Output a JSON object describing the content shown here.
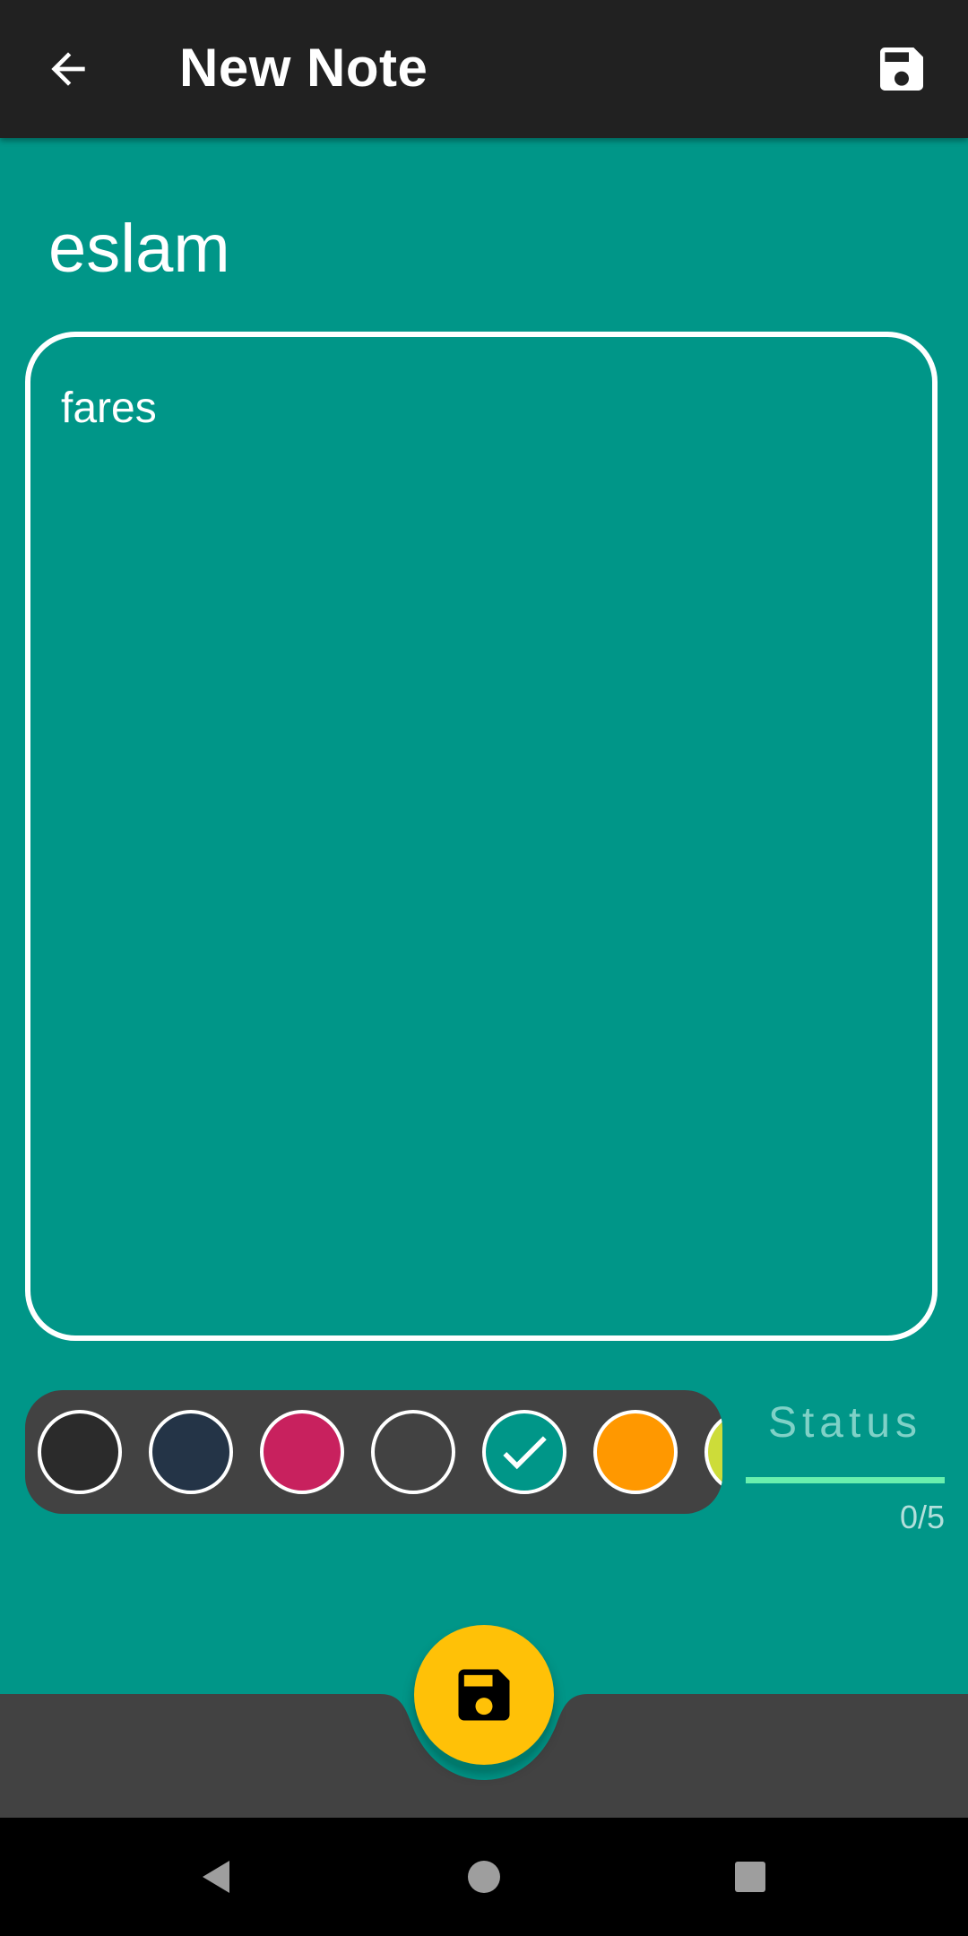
{
  "app_bar": {
    "title": "New Note",
    "back_icon": "arrow-back-icon",
    "save_icon": "save-icon",
    "background_color": "#212121"
  },
  "note": {
    "title": "eslam",
    "body": "fares",
    "background_color": "#009688"
  },
  "color_picker": {
    "background_color": "#424242",
    "selected": "teal",
    "swatches": [
      {
        "name": "black",
        "color": "#2b2b2b",
        "selected": false
      },
      {
        "name": "navy",
        "color": "#243447",
        "selected": false
      },
      {
        "name": "pink",
        "color": "#c8215e",
        "selected": false
      },
      {
        "name": "dark-gray",
        "color": "#424242",
        "selected": false
      },
      {
        "name": "teal",
        "color": "#009688",
        "selected": true
      },
      {
        "name": "orange",
        "color": "#ff9800",
        "selected": false
      },
      {
        "name": "yellow",
        "color": "#cddc39",
        "selected": false
      }
    ]
  },
  "status": {
    "label": "Status",
    "counter": "0/5",
    "underline_color": "#69f0ae"
  },
  "bottom_bar": {
    "background_color": "#424242",
    "fab_icon": "save-icon",
    "fab_color": "#ffc107"
  },
  "system_nav": {
    "back_icon": "nav-back-icon",
    "home_icon": "nav-home-icon",
    "recents_icon": "nav-recents-icon"
  }
}
